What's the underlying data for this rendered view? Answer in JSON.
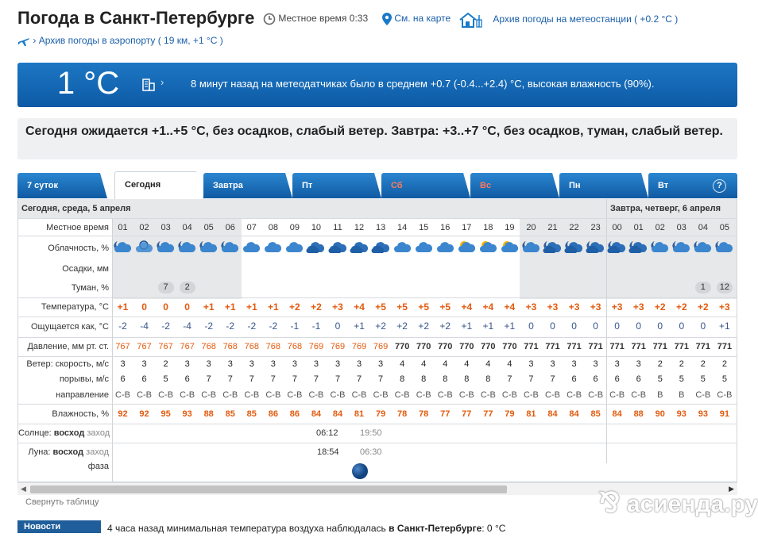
{
  "header": {
    "title": "Погода в Санкт-Петербурге",
    "local_time_label": "Местное время",
    "local_time": "0:33",
    "map_link": "См. на карте",
    "station_archive": "Архив погоды на метеостанции ( +0.2 °C )",
    "airport_archive": "Архив погоды в аэропорту ( 19 км, +1 °C )"
  },
  "now": {
    "temp": "1 °C",
    "text": "8 минут назад на метеодатчиках было в среднем +0.7 (-0.4...+2.4) °C, высокая влажность (90%)."
  },
  "forecast_text": "Сегодня ожидается +1..+5 °C, без осадков, слабый ветер. Завтра: +3..+7 °C, без осадков, туман, слабый ветер.",
  "tabs": [
    {
      "label": "7 суток"
    },
    {
      "label": "Сегодня",
      "active": true
    },
    {
      "label": "Завтра"
    },
    {
      "label": "Пт"
    },
    {
      "label": "Сб",
      "weekend": true
    },
    {
      "label": "Вс",
      "weekend": true
    },
    {
      "label": "Пн"
    },
    {
      "label": "Вт"
    }
  ],
  "help": "?",
  "days": [
    {
      "label": "Сегодня, среда, 5 апреля"
    },
    {
      "label": "Завтра, четверг, 6 апреля"
    }
  ],
  "row_labels": {
    "time": "Местное время",
    "cloud": "Облачность, %",
    "precip": "Осадки, мм",
    "fog": "Туман, %",
    "temp": "Температура, °C",
    "feels": "Ощущается как, °C",
    "pressure": "Давление, мм рт. ст.",
    "wind_speed": "Ветер: скорость, м/с",
    "gusts": "порывы, м/с",
    "direction": "направление",
    "humidity": "Влажность, %",
    "sun_a": "Солнце:",
    "sun_b": "восход",
    "sun_c": "заход",
    "moon_a": "Луна:",
    "moon_b": "восход",
    "moon_c": "заход",
    "phase": "фаза"
  },
  "hours": [
    "01",
    "02",
    "03",
    "04",
    "05",
    "06",
    "07",
    "08",
    "09",
    "10",
    "11",
    "12",
    "13",
    "14",
    "15",
    "16",
    "17",
    "18",
    "19",
    "20",
    "21",
    "22",
    "23",
    "00",
    "01",
    "02",
    "03",
    "04",
    "05"
  ],
  "cloud_icons": [
    "cloud-night",
    "moon-cloud",
    "cloud-night",
    "cloud-night",
    "cloud-night",
    "cloud-night",
    "partly-cloudy",
    "partly-cloudy",
    "partly-cloudy",
    "cloudy",
    "cloudy",
    "cloudy",
    "cloudy",
    "partly-cloudy",
    "partly-cloudy",
    "partly-cloudy",
    "sun-cloud",
    "sun-cloud",
    "sun-cloud",
    "cloud-night",
    "cloudy-night",
    "cloudy-night",
    "cloudy-night",
    "cloudy-night",
    "cloudy-night",
    "cloud-night",
    "cloud-night",
    "cloud-night",
    "cloud-night"
  ],
  "fog": [
    "",
    "",
    "7",
    "2",
    "",
    "",
    "",
    "",
    "",
    "",
    "",
    "",
    "",
    "",
    "",
    "",
    "",
    "",
    "",
    "",
    "",
    "",
    "",
    "",
    "",
    "",
    "",
    "1",
    "12"
  ],
  "temp": [
    "+1",
    "0",
    "0",
    "0",
    "+1",
    "+1",
    "+1",
    "+1",
    "+2",
    "+2",
    "+3",
    "+4",
    "+5",
    "+5",
    "+5",
    "+5",
    "+4",
    "+4",
    "+4",
    "+3",
    "+3",
    "+3",
    "+3",
    "+3",
    "+3",
    "+2",
    "+2",
    "+2",
    "+3"
  ],
  "feels": [
    "-2",
    "-4",
    "-2",
    "-4",
    "-2",
    "-2",
    "-2",
    "-2",
    "-1",
    "-1",
    "0",
    "+1",
    "+2",
    "+2",
    "+2",
    "+2",
    "+1",
    "+1",
    "+1",
    "0",
    "0",
    "0",
    "0",
    "0",
    "0",
    "0",
    "0",
    "0",
    "+1"
  ],
  "pressure": [
    "767",
    "767",
    "767",
    "767",
    "768",
    "768",
    "768",
    "768",
    "768",
    "769",
    "769",
    "769",
    "769",
    "770",
    "770",
    "770",
    "770",
    "770",
    "770",
    "771",
    "771",
    "771",
    "771",
    "771",
    "771",
    "771",
    "771",
    "771",
    "771"
  ],
  "wind": [
    "3",
    "3",
    "2",
    "3",
    "3",
    "3",
    "3",
    "3",
    "3",
    "3",
    "3",
    "3",
    "3",
    "4",
    "4",
    "4",
    "4",
    "4",
    "4",
    "3",
    "3",
    "3",
    "3",
    "3",
    "3",
    "2",
    "2",
    "2",
    "2"
  ],
  "gusts": [
    "6",
    "6",
    "5",
    "6",
    "7",
    "7",
    "7",
    "7",
    "7",
    "7",
    "7",
    "7",
    "7",
    "8",
    "8",
    "8",
    "8",
    "8",
    "7",
    "7",
    "7",
    "6",
    "6",
    "6",
    "6",
    "5",
    "5",
    "5",
    "5"
  ],
  "direction": [
    "С-В",
    "С-В",
    "С-В",
    "С-В",
    "С-В",
    "С-В",
    "С-В",
    "С-В",
    "С-В",
    "С-В",
    "С-В",
    "С-В",
    "С-В",
    "С-В",
    "С-В",
    "С-В",
    "С-В",
    "С-В",
    "С-В",
    "С-В",
    "С-В",
    "С-В",
    "С-В",
    "С-В",
    "С-В",
    "В",
    "В",
    "С-В",
    "С-В"
  ],
  "humidity": [
    "92",
    "92",
    "95",
    "93",
    "88",
    "85",
    "85",
    "86",
    "86",
    "84",
    "84",
    "81",
    "79",
    "78",
    "78",
    "77",
    "77",
    "77",
    "79",
    "81",
    "84",
    "84",
    "85",
    "84",
    "88",
    "90",
    "93",
    "93",
    "91"
  ],
  "sun": {
    "rise": "06:12",
    "set": "19:50"
  },
  "moon": {
    "rise": "18:54",
    "set": "06:30",
    "phase": "full"
  },
  "collapse": "Свернуть таблицу",
  "news": {
    "button": "Новости погоды",
    "text_pre": "4 часа назад минимальная температура воздуха наблюдалась ",
    "text_place": "в Санкт-Петербурге",
    "text_post": ": 0 °C"
  },
  "watermark": "асиенда.ру"
}
